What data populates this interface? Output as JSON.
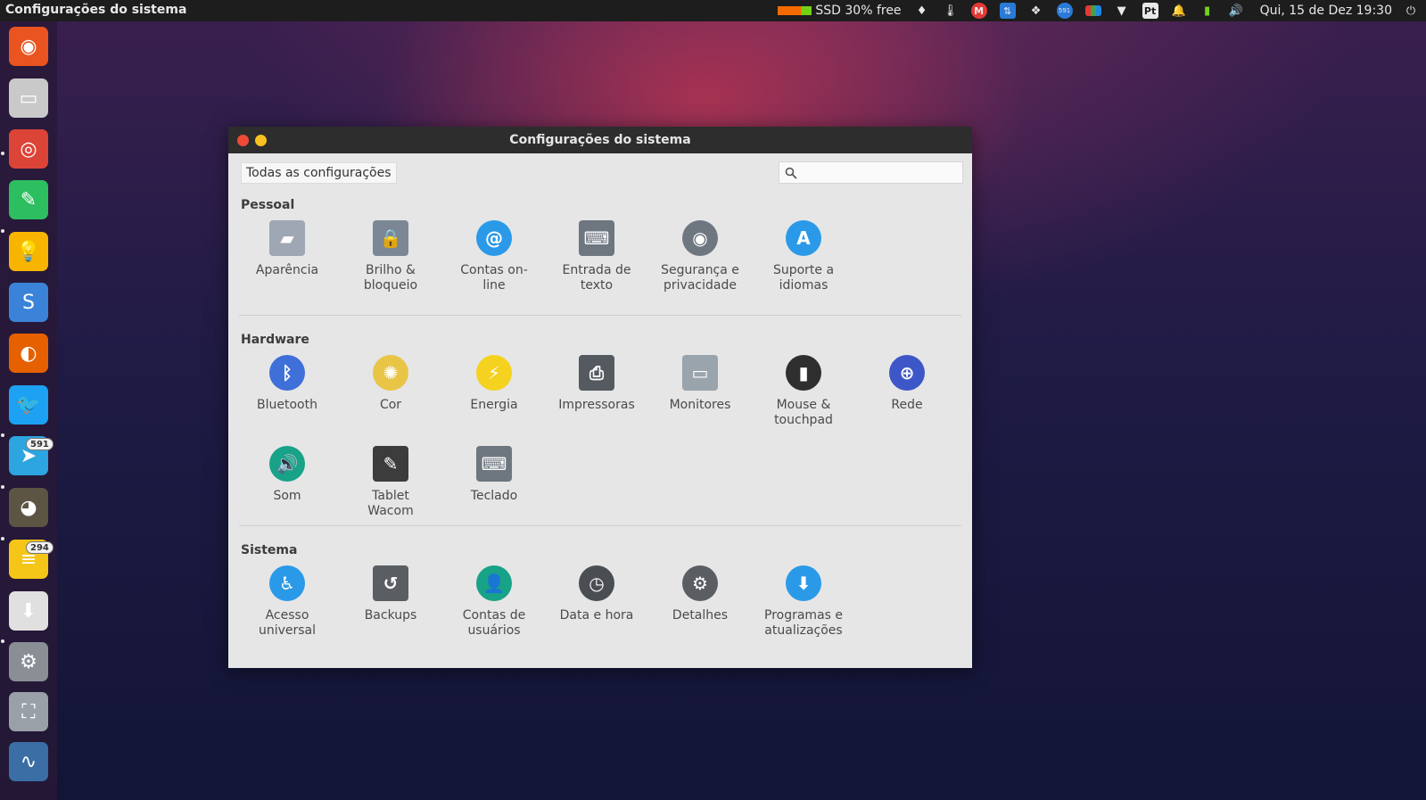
{
  "topbar": {
    "title": "Configurações do sistema",
    "ssd": "SSD 30% free",
    "clock": "Qui, 15 de Dez 19:30",
    "tray_icons": [
      "lightbulb-icon",
      "thermometer-icon",
      "gmail-icon",
      "network-icon",
      "dropbox-icon",
      "chrome-badge-icon",
      "chart-icon",
      "wifi-icon",
      "keyboard-layout-icon",
      "bell-icon",
      "battery-icon",
      "volume-icon",
      "power-icon"
    ],
    "keyboard_layout": "Pt",
    "chrome_badge": "591"
  },
  "launcher": {
    "items": [
      {
        "name": "ubuntu-icon",
        "color": "#e95420",
        "glyph": "◉"
      },
      {
        "name": "files-icon",
        "color": "#c9c9c9",
        "glyph": "▭"
      },
      {
        "name": "chrome-icon",
        "color": "#db4437",
        "glyph": "◎"
      },
      {
        "name": "evernote-icon",
        "color": "#2dbe60",
        "glyph": "✎"
      },
      {
        "name": "keep-icon",
        "color": "#f7b500",
        "glyph": "💡"
      },
      {
        "name": "simplenote-icon",
        "color": "#3b83d8",
        "glyph": "S"
      },
      {
        "name": "firefox-icon",
        "color": "#e66000",
        "glyph": "◐"
      },
      {
        "name": "twitter-icon",
        "color": "#1da1f2",
        "glyph": "🐦"
      },
      {
        "name": "telegram-icon",
        "color": "#2ca5e0",
        "glyph": "➤"
      },
      {
        "name": "gimp-icon",
        "color": "#5c5543",
        "glyph": "◕"
      },
      {
        "name": "rss-icon",
        "color": "#f5c518",
        "glyph": "≡"
      },
      {
        "name": "software-update-icon",
        "color": "#e0e0e0",
        "glyph": "⬇"
      },
      {
        "name": "settings-icon",
        "color": "#8a8f96",
        "glyph": "⚙"
      },
      {
        "name": "screenshot-icon",
        "color": "#9aa0a8",
        "glyph": "⛶"
      },
      {
        "name": "system-monitor-icon",
        "color": "#3a6ea5",
        "glyph": "∿"
      }
    ],
    "badges": {
      "telegram": "591",
      "rss": "294"
    }
  },
  "window": {
    "title": "Configurações do sistema",
    "all_settings_label": "Todas as configurações",
    "search": {
      "placeholder": "",
      "value": ""
    },
    "sections": [
      {
        "title": "Pessoal",
        "items": [
          {
            "label": "Aparência",
            "icon": "appearance-icon",
            "color": "#9ea7b3"
          },
          {
            "label": "Brilho & bloqueio",
            "icon": "brightness-lock-icon",
            "color": "#7b8794"
          },
          {
            "label": "Contas on-line",
            "icon": "online-accounts-icon",
            "color": "#2a9ae8"
          },
          {
            "label": "Entrada de texto",
            "icon": "text-entry-icon",
            "color": "#6e7680"
          },
          {
            "label": "Segurança e privacidade",
            "icon": "security-privacy-icon",
            "color": "#6e7680"
          },
          {
            "label": "Suporte a idiomas",
            "icon": "language-support-icon",
            "color": "#2a9ae8"
          }
        ]
      },
      {
        "title": "Hardware",
        "items": [
          {
            "label": "Bluetooth",
            "icon": "bluetooth-icon",
            "color": "#3f6fd8"
          },
          {
            "label": "Cor",
            "icon": "color-icon",
            "color": "#e8c547"
          },
          {
            "label": "Energia",
            "icon": "power-icon",
            "color": "#f4d21f"
          },
          {
            "label": "Impressoras",
            "icon": "printer-icon",
            "color": "#555a60"
          },
          {
            "label": "Monitores",
            "icon": "displays-icon",
            "color": "#9aa4ad"
          },
          {
            "label": "Mouse & touchpad",
            "icon": "mouse-icon",
            "color": "#2f2f2f"
          },
          {
            "label": "Rede",
            "icon": "network-icon",
            "color": "#3d57c8"
          },
          {
            "label": "Som",
            "icon": "sound-icon",
            "color": "#18a287"
          },
          {
            "label": "Tablet Wacom",
            "icon": "wacom-tablet-icon",
            "color": "#3c3c3c"
          },
          {
            "label": "Teclado",
            "icon": "keyboard-icon",
            "color": "#6e7680"
          }
        ]
      },
      {
        "title": "Sistema",
        "items": [
          {
            "label": "Acesso universal",
            "icon": "universal-access-icon",
            "color": "#2a9ae8"
          },
          {
            "label": "Backups",
            "icon": "backups-icon",
            "color": "#5a5e63"
          },
          {
            "label": "Contas de usuários",
            "icon": "user-accounts-icon",
            "color": "#18a287"
          },
          {
            "label": "Data e hora",
            "icon": "date-time-icon",
            "color": "#4a4e53"
          },
          {
            "label": "Detalhes",
            "icon": "details-icon",
            "color": "#5a5e63"
          },
          {
            "label": "Programas e atualizações",
            "icon": "software-updates-icon",
            "color": "#2a9ae8"
          }
        ]
      }
    ]
  }
}
